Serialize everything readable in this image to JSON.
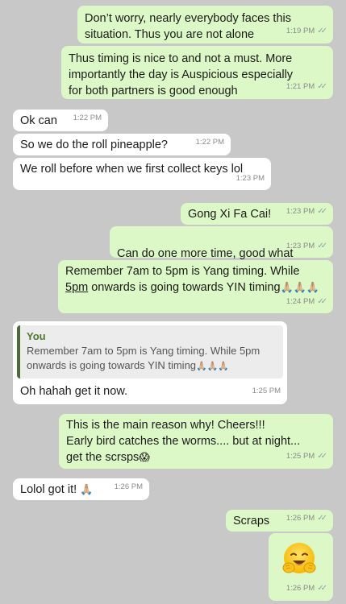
{
  "messages": [
    {
      "text": "Don’t worry, nearly everybody faces this\nsituation. Thus you are not alone",
      "time": "1:19 PM"
    },
    {
      "text": "Thus timing is nice to and not a must. More\nimportantly the day is Auspicious especially\nfor both partners is good enough",
      "time": "1:21 PM"
    },
    {
      "text": "Ok can",
      "time": "1:22 PM"
    },
    {
      "text": "So we do the roll pineapple?",
      "time": "1:22 PM"
    },
    {
      "text": "We roll before when we first collect keys lol",
      "time": "1:23 PM"
    },
    {
      "text": "Gong Xi Fa Cai!",
      "time": "1:23 PM"
    },
    {
      "text": "Can do one more time, good what",
      "emoji": "💰",
      "time": "1:23 PM"
    },
    {
      "line1": "Remember 7am to 5pm is Yang timing. While",
      "line2_u": "5pm",
      "line2_rest": " onwards is going towards YIN timing",
      "emoji": "🙏🏼🙏🏼🙏🏼",
      "time": "1:24 PM"
    },
    {
      "quote_author": "You",
      "quote_text": "Remember 7am to 5pm is Yang timing. While 5pm\nonwards is going towards YIN timing",
      "quote_emoji": "🙏🏼🙏🏼🙏🏼",
      "text": "Oh hahah get it now.",
      "time": "1:25 PM"
    },
    {
      "text": "This is the main reason why! Cheers!!!\nEarly bird catches the worms.... but at night...\nget the scrsps",
      "emoji": "😱",
      "time": "1:25 PM"
    },
    {
      "text": "Lolol got it!",
      "emoji": "🙏🏼",
      "time": "1:26 PM"
    },
    {
      "text": "Scraps",
      "time": "1:26 PM"
    },
    {
      "emoji_name": "hugging-face-emoji",
      "time": "1:26 PM"
    }
  ],
  "read_receipt": "✓✓"
}
